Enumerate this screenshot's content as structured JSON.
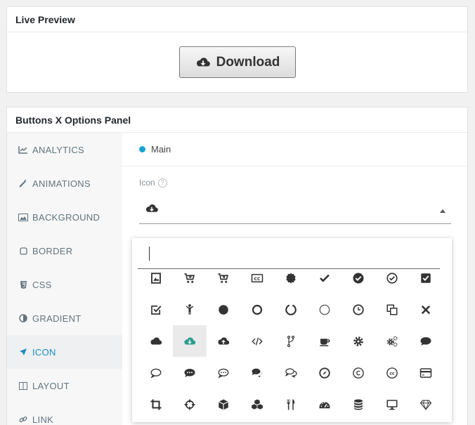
{
  "preview": {
    "title": "Live Preview",
    "button_label": "Download"
  },
  "options": {
    "title": "Buttons X Options Panel",
    "sidebar": [
      {
        "label": "ANALYTICS",
        "icon": "chart-icon"
      },
      {
        "label": "ANIMATIONS",
        "icon": "magic-wand-icon"
      },
      {
        "label": "BACKGROUND",
        "icon": "image-icon"
      },
      {
        "label": "BORDER",
        "icon": "square-icon"
      },
      {
        "label": "CSS",
        "icon": "css3-icon"
      },
      {
        "label": "GRADIENT",
        "icon": "adjust-icon"
      },
      {
        "label": "ICON",
        "icon": "rocket-icon",
        "active": true
      },
      {
        "label": "LAYOUT",
        "icon": "columns-icon"
      },
      {
        "label": "LINK",
        "icon": "link-icon"
      }
    ],
    "tab": {
      "label": "Main",
      "dot_color": "#1aa3d6"
    },
    "icon_field": {
      "label": "Icon",
      "help": "?",
      "selected_icon": "cloud-download-icon"
    },
    "icon_picker": {
      "search_value": "",
      "icons": [
        "image-frame-icon",
        "cart-plus-icon",
        "cart-arrow-icon",
        "closed-captioning-icon",
        "certificate-icon",
        "check-icon",
        "check-circle-icon",
        "check-circle-outline-icon",
        "check-square-icon",
        "check-square-outline-icon",
        "child-icon",
        "circle-icon",
        "circle-outline-icon",
        "circle-notch-icon",
        "circle-thin-icon",
        "clock-icon",
        "clone-icon",
        "close-icon",
        "cloud-icon",
        "cloud-download-icon",
        "cloud-upload-icon",
        "code-icon",
        "code-fork-icon",
        "coffee-icon",
        "cog-icon",
        "cogs-icon",
        "comment-icon",
        "comment-outline-icon",
        "commenting-icon",
        "commenting-outline-icon",
        "comments-icon",
        "comments-outline-icon",
        "compass-icon",
        "copyright-icon",
        "creative-commons-icon",
        "credit-card-icon",
        "crop-icon",
        "crosshairs-icon",
        "cube-icon",
        "cubes-icon",
        "cutlery-icon",
        "dashboard-icon",
        "database-icon",
        "desktop-icon",
        "diamond-icon"
      ],
      "selected_index": 19
    }
  },
  "colors": {
    "accent": "#1e8cbe",
    "teal": "#2a9d8f"
  }
}
